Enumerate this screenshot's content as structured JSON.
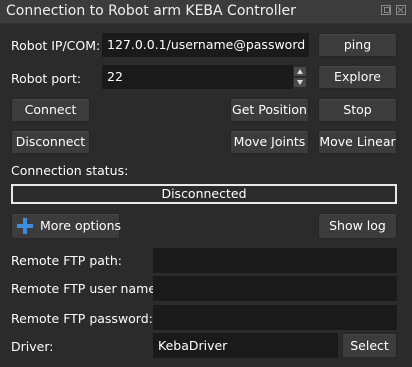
{
  "window": {
    "title": "Connection to Robot arm KEBA Controller"
  },
  "connection": {
    "ip_label": "Robot IP/COM:",
    "ip_value": "127.0.0.1/username@password",
    "port_label": "Robot port:",
    "port_value": "22",
    "ping_label": "ping",
    "explore_label": "Explore",
    "connect_label": "Connect",
    "disconnect_label": "Disconnect",
    "get_position_label": "Get Position",
    "stop_label": "Stop",
    "move_joints_label": "Move Joints",
    "move_linear_label": "Move Linear",
    "status_label": "Connection status:",
    "status_value": "Disconnected"
  },
  "options": {
    "more_options_label": "More options",
    "show_log_label": "Show log",
    "ftp_path_label": "Remote FTP path:",
    "ftp_path_value": "",
    "ftp_user_label": "Remote FTP user name:",
    "ftp_user_value": "",
    "ftp_password_label": "Remote FTP password:",
    "ftp_password_value": "",
    "driver_label": "Driver:",
    "driver_value": "KebaDriver",
    "select_label": "Select"
  },
  "icons": {
    "float": "float-window-icon",
    "close": "close-icon",
    "more_options": "plus-icon",
    "spin_up": "spin-up-icon",
    "spin_down": "spin-down-icon"
  },
  "colors": {
    "background": "#2b2b2b",
    "input_background": "#1a1a1a",
    "button_background": "#3c3c3c",
    "accent_blue": "#3d8ee0",
    "text": "#ffffff"
  }
}
